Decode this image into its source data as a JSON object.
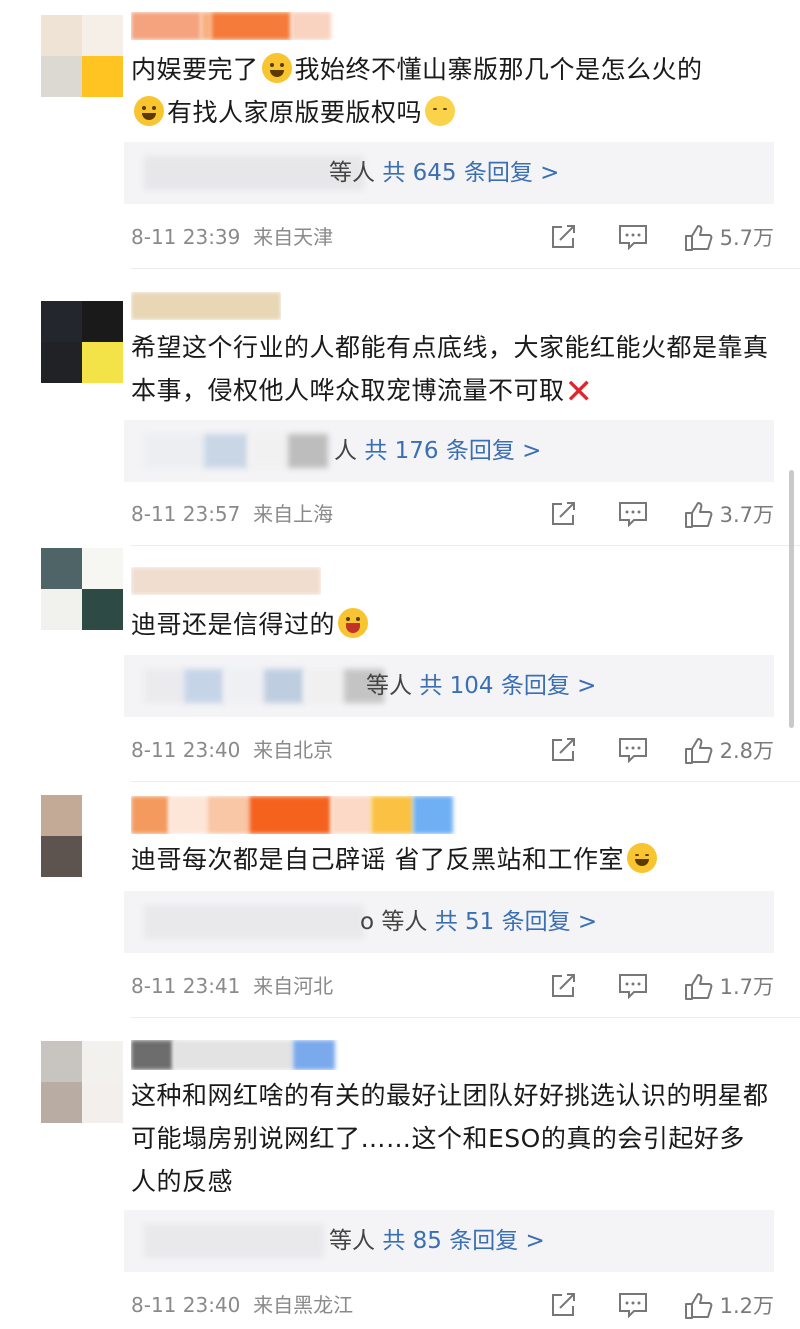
{
  "comments": [
    {
      "name_blur_colors": [
        "#f4a37e",
        "#f7b07f",
        "#f57b3a",
        "#f9d2c0"
      ],
      "avatar_colors": [
        "#efe3d5",
        "#f6efe8",
        "#dcd8d2",
        "#ffc322"
      ],
      "text_parts": [
        "内娱要完了",
        "我始终不懂山寨版那几个是怎么火的",
        "有找人家原版要版权吗"
      ],
      "reply_who": "等人",
      "reply_count": "共 645 条回复 >",
      "date": "8-11 23:39",
      "location": "来自天津",
      "likes": "5.7万"
    },
    {
      "name_blur_colors": [
        "#c9a46a",
        "#b79060",
        "#e3cfa8"
      ],
      "avatar_colors": [
        "#24262d",
        "#1a1a1a",
        "#202226",
        "#f3e348"
      ],
      "text_parts": [
        "希望这个行业的人都能有点底线，大家能红能火都是靠真本事，侵权他人哗众取宠博流量不可取"
      ],
      "reply_who": "人",
      "reply_count": "共 176 条回复 >",
      "date": "8-11 23:57",
      "location": "来自上海",
      "likes": "3.7万"
    },
    {
      "name_blur_colors": [
        "#d6a98c",
        "#c9a08a",
        "#f2c8a8"
      ],
      "avatar_colors": [
        "#4f6467",
        "#f6f6f2",
        "#f1f1ee",
        "#2d4a44"
      ],
      "text_parts": [
        "迪哥还是信得过的"
      ],
      "reply_who": "等人",
      "reply_count": "共 104 条回复 >",
      "date": "8-11 23:40",
      "location": "来自北京",
      "likes": "2.8万"
    },
    {
      "name_blur_colors": [
        "#f49a5f",
        "#f9c6a6",
        "#f5621e",
        "#fbd9c6",
        "#fac143",
        "#6fb0f5"
      ],
      "avatar_colors": [
        "#c2aa96",
        "#e5dcd5",
        "#5d5450",
        "#ece8e5"
      ],
      "text_parts": [
        "迪哥每次都是自己辟谣 省了反黑站和工作室"
      ],
      "reply_who": "o 等人",
      "reply_count": "共 51 条回复 >",
      "date": "8-11 23:41",
      "location": "来自河北",
      "likes": "1.7万"
    },
    {
      "name_blur_colors": [
        "#6d6d6d",
        "#d7d7d7",
        "#7aa9ec"
      ],
      "avatar_colors": [
        "#c8c5c1",
        "#f3f1ee",
        "#b8aca3",
        "#f2efec"
      ],
      "text_parts": [
        "这种和网红啥的有关的最好让团队好好挑选认识的明星都可能塌房别说网红了……这个和ESO的真的会引起好多人的反感"
      ],
      "reply_who": "等人",
      "reply_count": "共 85 条回复 >",
      "date": "8-11 23:40",
      "location": "来自黑龙江",
      "likes": "1.2万"
    }
  ]
}
